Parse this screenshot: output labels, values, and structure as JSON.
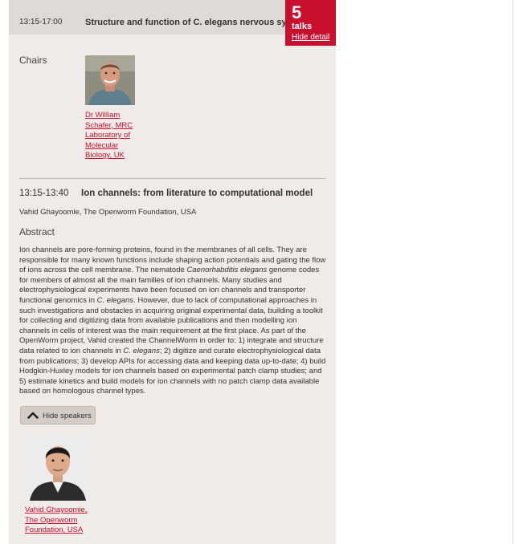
{
  "session": {
    "time": "13:15-17:00",
    "title": "Structure and function of C. elegans nervous system",
    "talk_count": "5",
    "talk_count_label": "talks",
    "hide_detail_label": "Hide detail"
  },
  "chairs": {
    "label": "Chairs",
    "items": [
      {
        "name": "Dr William Schafer, MRC Laboratory of Molecular Biology, UK"
      }
    ]
  },
  "talk": {
    "time": "13:15-13:40",
    "title": "Ion channels: from literature to computational model",
    "speaker": "Vahid Ghayoomie, The Openworm Foundation, USA",
    "abstract_heading": "Abstract",
    "abstract_parts": [
      "Ion channels are pore-forming proteins, found in the membranes of all cells. They are responsible for many known functions include shaping action potentials and gating the flow of ions across the cell membrane. The nematode ",
      "Caenorhabditis elegans",
      " genome codes for members of almost all the main families of ion channels. Many studies and electrophysiological experiments have been focused on ion channels and transporter functional genomics in ",
      "C. elegans",
      ". However, due to lack of computational approaches in such investigations and obstacles in acquiring original experimental data, building a toolkit for collecting and digitizing data from available publications and then modelling ion channels in cells of interest was the main requirement at the first place. As part of the OpenWorm project, Vahid created the ChannelWorm in order to: 1) integrate and structure data related to ion channels in ",
      "C. elegans",
      "; 2) digitize and curate electrophysiological data from publications; 3) develop APIs for accessing data and keeping data up-to-date; 4) build Hodgkin-Huxley models for ion channels based on experimental patch clamp studies; and 5) estimate kinetics and build models for ion channels with no patch clamp data available based on homologous channel types."
    ],
    "hide_speakers_label": "Hide speakers",
    "speakers": [
      {
        "name": "Vahid Ghayoomie, The Openworm Foundation, USA"
      }
    ]
  },
  "colors": {
    "accent": "#c8102e",
    "panel_bg": "#efebe8",
    "header_bg": "#dedad7"
  },
  "icons": {
    "hide_speakers": "chevron-up-icon",
    "chair_photo": "person-photo",
    "speaker_photo": "person-photo"
  }
}
